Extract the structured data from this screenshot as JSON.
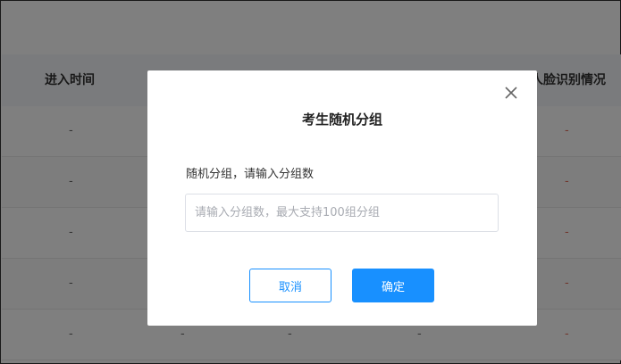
{
  "table": {
    "headers": {
      "entry_time": "进入时间",
      "face_recognition": "人脸识别情况"
    },
    "rows": [
      [
        "-",
        "-",
        "-",
        "-",
        "-"
      ],
      [
        "-",
        "-",
        "-",
        "-",
        "-"
      ],
      [
        "-",
        "-",
        "-",
        "-",
        "-"
      ],
      [
        "-",
        "-",
        "-",
        "-",
        "-"
      ],
      [
        "-",
        "-",
        "-",
        "-",
        "-"
      ]
    ]
  },
  "dialog": {
    "title": "考生随机分组",
    "label": "随机分组，请输入分组数",
    "input": {
      "value": "",
      "placeholder": "请输入分组数，最大支持100组分组"
    },
    "cancel_label": "取消",
    "confirm_label": "确定"
  },
  "colors": {
    "accent": "#1890ff",
    "status_red": "#e06c5a"
  },
  "icons": {
    "close": "close-icon"
  }
}
